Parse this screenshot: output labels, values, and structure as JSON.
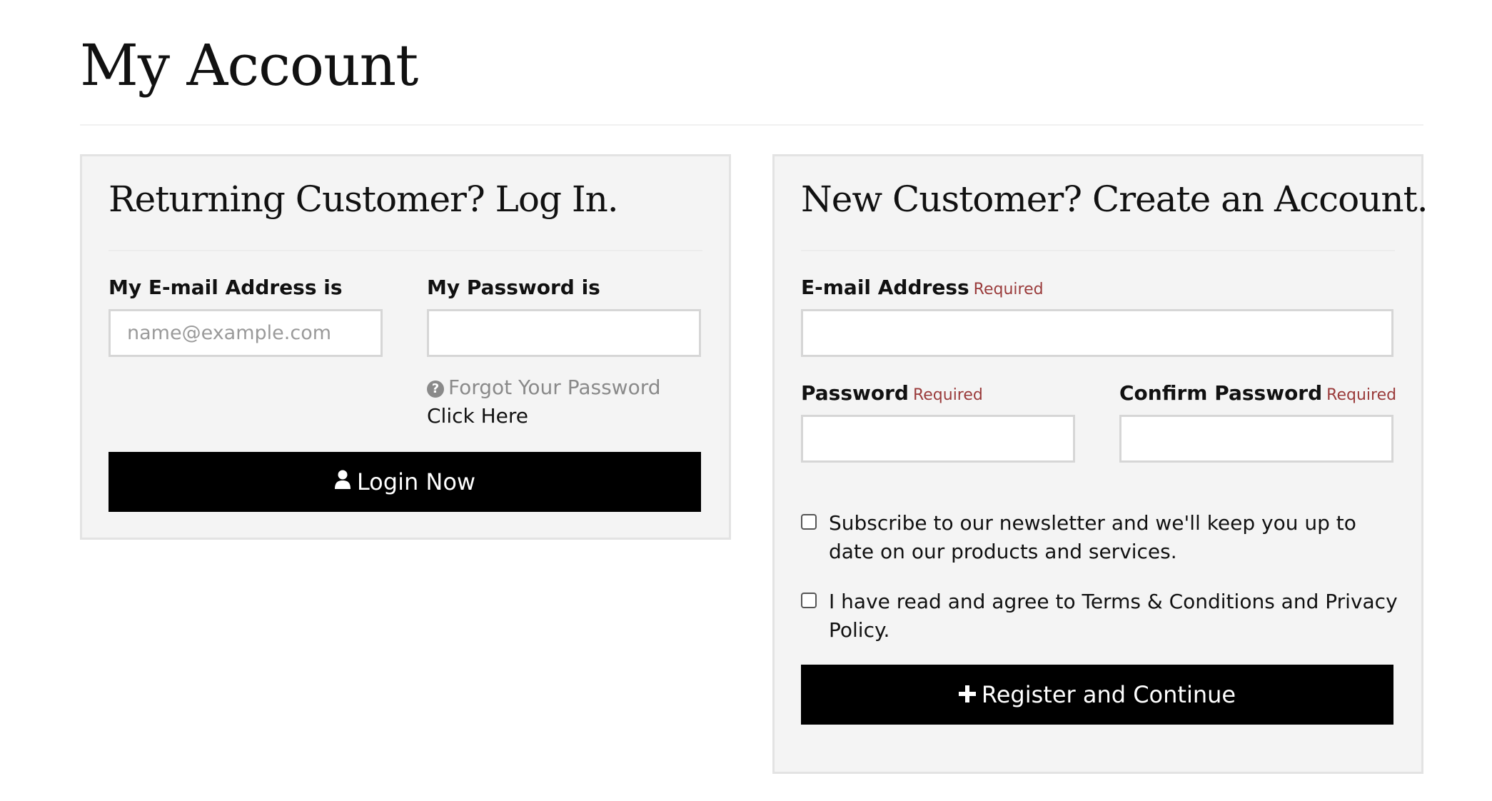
{
  "page": {
    "title": "My Account"
  },
  "login": {
    "heading": "Returning Customer? Log In.",
    "email_label": "My E-mail Address is",
    "email_placeholder": "name@example.com",
    "email_value": "",
    "password_label": "My Password is",
    "password_value": "",
    "forgot_icon": "question-circle-icon",
    "forgot_text": "Forgot Your Password",
    "forgot_link": "Click Here",
    "button_icon": "user-icon",
    "button_label": "Login Now"
  },
  "register": {
    "heading": "New Customer? Create an Account.",
    "email_label": "E-mail Address",
    "email_required": "Required",
    "email_value": "",
    "password_label": "Password",
    "password_required": "Required",
    "password_value": "",
    "confirm_label": "Confirm Password",
    "confirm_required": "Required",
    "confirm_value": "",
    "newsletter_text": "Subscribe to our newsletter and we'll keep you up to date on our products and services.",
    "newsletter_checked": false,
    "terms_text": "I have read and agree to Terms & Conditions and Privacy Policy.",
    "terms_checked": false,
    "button_icon": "plus-icon",
    "button_label": "Register and Continue"
  },
  "colors": {
    "panel_bg": "#f4f4f4",
    "button_bg": "#000000",
    "required": "#9a3b3b"
  }
}
